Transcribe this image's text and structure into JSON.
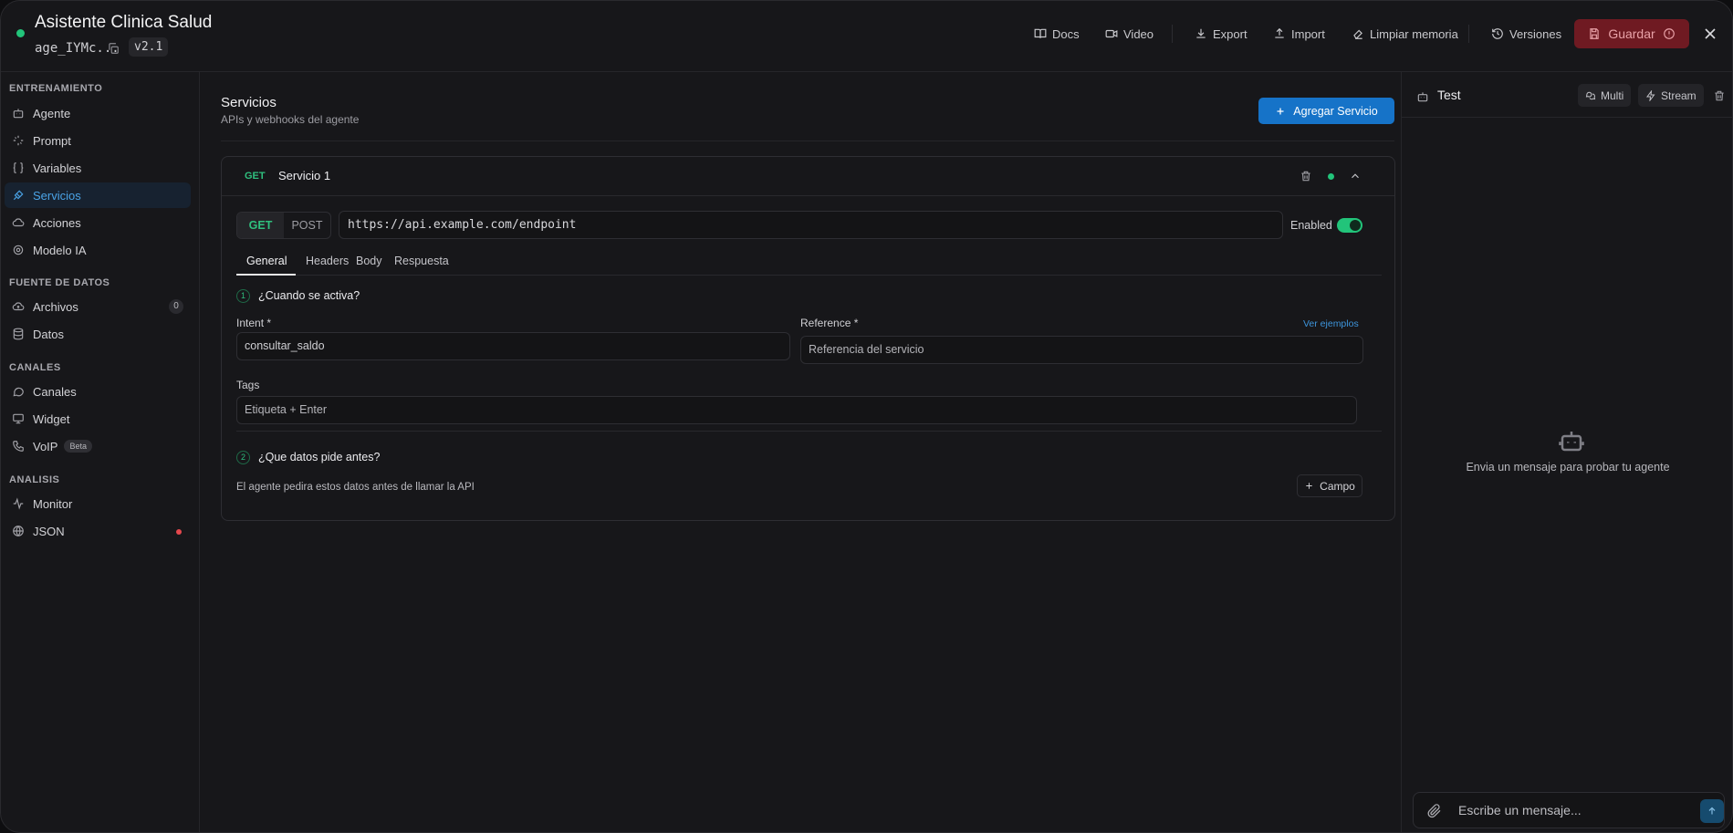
{
  "header": {
    "title": "Asistente Clinica Salud",
    "agent_id": "age_IYMc...",
    "version": "v2.1",
    "buttons": {
      "docs": "Docs",
      "video": "Video",
      "export": "Export",
      "import": "Import",
      "clear_memory": "Limpiar memoria",
      "versions": "Versiones",
      "save": "Guardar"
    }
  },
  "sidebar": {
    "sections": [
      {
        "label": "ENTRENAMIENTO"
      },
      {
        "label": "FUENTE DE DATOS"
      },
      {
        "label": "CANALES"
      },
      {
        "label": "ANALISIS"
      }
    ],
    "items": [
      {
        "label": "Agente",
        "icon": "bot-icon"
      },
      {
        "label": "Prompt",
        "icon": "sparkle-icon"
      },
      {
        "label": "Variables",
        "icon": "braces-icon"
      },
      {
        "label": "Servicios",
        "icon": "plug-icon",
        "active": true
      },
      {
        "label": "Acciones",
        "icon": "cloud-icon"
      },
      {
        "label": "Modelo IA",
        "icon": "cpu-icon"
      },
      {
        "label": "Archivos",
        "icon": "upload-cloud-icon",
        "badge": "0"
      },
      {
        "label": "Datos",
        "icon": "database-icon"
      },
      {
        "label": "Canales",
        "icon": "chat-icon"
      },
      {
        "label": "Widget",
        "icon": "monitor-icon"
      },
      {
        "label": "VoIP",
        "icon": "phone-icon",
        "badge": "Beta"
      },
      {
        "label": "Monitor",
        "icon": "activity-icon"
      },
      {
        "label": "JSON",
        "icon": "globe-icon"
      }
    ]
  },
  "main": {
    "title": "Servicios",
    "subtitle": "APIs y webhooks del agente",
    "add_button": "Agregar Servicio",
    "service": {
      "method_tag": "GET",
      "name": "Servicio 1",
      "methods": [
        "GET",
        "POST"
      ],
      "url": "https://api.example.com/endpoint",
      "enabled_label": "Enabled",
      "enabled": true,
      "tabs": [
        "General",
        "Headers",
        "Body",
        "Respuesta"
      ],
      "step1": {
        "num": "1",
        "title": "¿Cuando se activa?"
      },
      "intent": {
        "label": "Intent *",
        "value": "consultar_saldo"
      },
      "reference": {
        "label": "Reference *",
        "placeholder": "Referencia del servicio",
        "link": "Ver ejemplos"
      },
      "tags": {
        "label": "Tags",
        "placeholder": "Etiqueta + Enter"
      },
      "step2": {
        "num": "2",
        "title": "¿Que datos pide antes?"
      },
      "helper": "El agente pedira estos datos antes de llamar la API",
      "field_button": "Campo"
    }
  },
  "test_panel": {
    "title": "Test",
    "multi": "Multi",
    "stream": "Stream",
    "empty_text": "Envia un mensaje para probar tu agente",
    "input_placeholder": "Escribe un mensaje..."
  },
  "colors": {
    "accent": "#1673c8",
    "success": "#22c47a",
    "danger": "#6f1a22"
  }
}
